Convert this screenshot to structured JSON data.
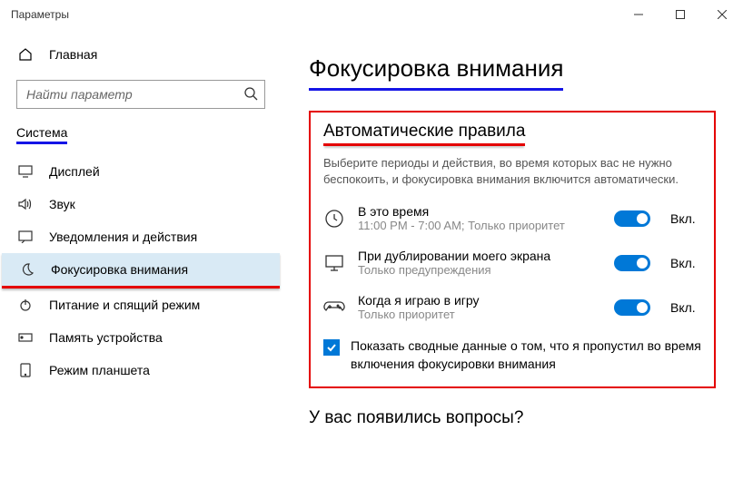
{
  "window": {
    "title": "Параметры"
  },
  "sidebar": {
    "home": "Главная",
    "search_placeholder": "Найти параметр",
    "section": "Система",
    "items": [
      {
        "label": "Дисплей"
      },
      {
        "label": "Звук"
      },
      {
        "label": "Уведомления и действия"
      },
      {
        "label": "Фокусировка внимания"
      },
      {
        "label": "Питание и спящий режим"
      },
      {
        "label": "Память устройства"
      },
      {
        "label": "Режим планшета"
      }
    ]
  },
  "main": {
    "title": "Фокусировка внимания",
    "section_heading": "Автоматические правила",
    "section_desc": "Выберите периоды и действия, во время которых вас не нужно беспокоить, и фокусировка внимания включится автоматически.",
    "rules": [
      {
        "title": "В это время",
        "sub": "11:00 PM - 7:00 AM; Только приоритет",
        "state": "Вкл."
      },
      {
        "title": "При дублировании моего экрана",
        "sub": "Только предупреждения",
        "state": "Вкл."
      },
      {
        "title": "Когда я играю в игру",
        "sub": "Только приоритет",
        "state": "Вкл."
      }
    ],
    "summary_check": "Показать сводные данные о том, что я пропустил во время включения фокусировки внимания",
    "questions": "У вас появились вопросы?"
  }
}
